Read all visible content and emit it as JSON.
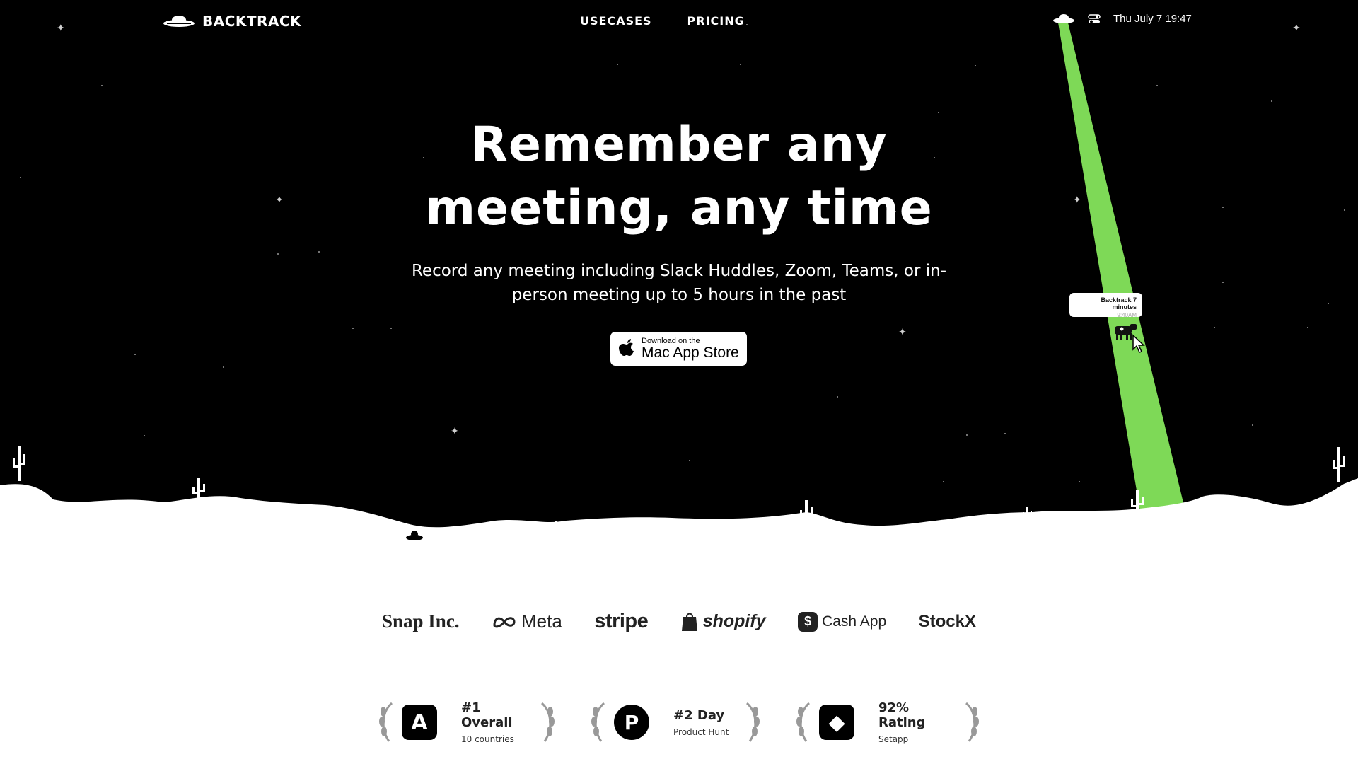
{
  "nav": {
    "logo_text": "BACKTRACK",
    "links": [
      "USECASES",
      "PRICING"
    ],
    "clock": "Thu July 7 19:47"
  },
  "hero": {
    "headline_line1": "Remember any",
    "headline_line2": "meeting, any time",
    "subline_line1": "Record any meeting including Slack Huddles, Zoom, Teams, or in-",
    "subline_line2": "person meeting up to 5 hours in the past",
    "appstore_small": "Download on the",
    "appstore_big": "Mac App Store"
  },
  "beam": {
    "tooltip_title": "Backtrack 7 minutes",
    "tooltip_time": "9:40AM",
    "color": "#7ed957"
  },
  "logos": [
    "Snap Inc.",
    "Meta",
    "stripe",
    "shopify",
    "Cash App",
    "StockX"
  ],
  "awards": [
    {
      "title": "#1 Overall",
      "sub": "10 countries",
      "icon": "app-store-icon"
    },
    {
      "title": "#2 Day",
      "sub": "Product Hunt",
      "icon": "product-hunt-icon"
    },
    {
      "title": "92% Rating",
      "sub": "Setapp",
      "icon": "setapp-icon"
    }
  ]
}
